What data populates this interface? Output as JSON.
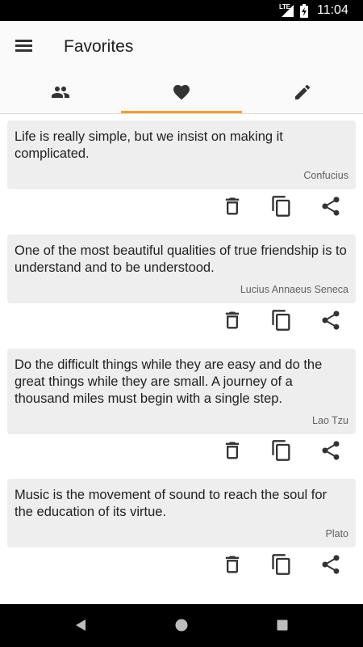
{
  "status_bar": {
    "network": "LTE",
    "time": "11:04",
    "icons": [
      "signal-icon",
      "battery-charging-icon"
    ]
  },
  "app_bar": {
    "title": "Favorites",
    "menu_icon": "hamburger-menu-icon"
  },
  "tabs": [
    {
      "icon": "people-icon",
      "active": false
    },
    {
      "icon": "heart-icon",
      "active": true
    },
    {
      "icon": "pencil-icon",
      "active": false
    }
  ],
  "quotes": [
    {
      "text": "Life is really simple, but we insist on making it complicated.",
      "author": "Confucius"
    },
    {
      "text": "One of the most beautiful qualities of true friendship is to understand and to be understood.",
      "author": "Lucius Annaeus Seneca"
    },
    {
      "text": "Do the difficult things while they are easy and do the great things while they are small. A journey of a thousand miles must begin with a single step.",
      "author": "Lao Tzu"
    },
    {
      "text": "Music is the movement of sound to reach the soul for the education of its virtue.",
      "author": "Plato"
    }
  ],
  "quote_actions": [
    "delete-icon",
    "copy-icon",
    "share-icon"
  ],
  "nav_bar": [
    "back-icon",
    "home-icon",
    "recents-icon"
  ],
  "colors": {
    "accent": "#f0a030",
    "card_background": "#eeeeee",
    "app_bar_background": "#fafafa",
    "icon": "#333333"
  }
}
